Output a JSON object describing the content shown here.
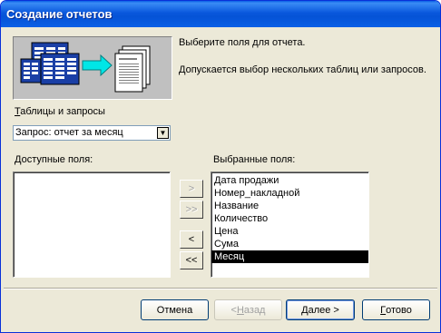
{
  "window": {
    "title": "Создание отчетов"
  },
  "intro": {
    "line1": "Выберите поля для отчета.",
    "line2": "Допускается выбор нескольких таблиц или запросов."
  },
  "source": {
    "label": "Таблицы и запросы",
    "label_hotkey": "Т",
    "label_rest": "аблицы и запросы",
    "selected": "Запрос: отчет за месяц"
  },
  "available": {
    "label": "Доступные поля:",
    "label_hotkey": "Д",
    "label_rest": "оступные поля:",
    "items": []
  },
  "selected_fields": {
    "label": "Выбранные поля:",
    "items": [
      "Дата продажи",
      "Номер_накладной",
      "Название",
      "Количество",
      "Цена",
      "Сума",
      "Месяц"
    ],
    "selected_item": "Месяц"
  },
  "move_buttons": {
    "add_one": ">",
    "add_all": ">>",
    "remove_one": "<",
    "remove_all": "<<"
  },
  "buttons": {
    "cancel": "Отмена",
    "back": "< Назад",
    "back_pre": "< ",
    "back_hotkey": "Н",
    "back_rest": "азад",
    "next": "Далее >",
    "next_hotkey": "Д",
    "next_rest": "алее >",
    "finish": "Готово",
    "finish_hotkey": "Г",
    "finish_rest": "отово"
  },
  "colors": {
    "titlebar": "#0a5fe6",
    "dialog_bg": "#ece9d8",
    "selection": "#000000",
    "illustration_bg": "#c0c0c0",
    "arrow": "#00e6e6",
    "grid_blue": "#1a3fa6"
  }
}
